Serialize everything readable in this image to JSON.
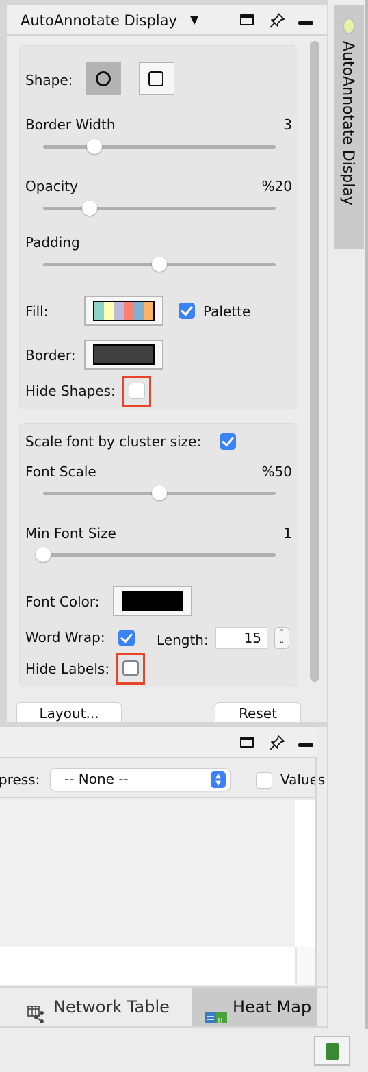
{
  "panel": {
    "title": "AutoAnnotate Display",
    "dropdown_icon": "triangle-down-icon",
    "header_icons": [
      "maximize-icon",
      "pin-icon",
      "minimize-icon"
    ]
  },
  "shape_group": {
    "shape_label": "Shape:",
    "shapes": [
      {
        "name": "ellipse",
        "icon": "circle-icon",
        "selected": true
      },
      {
        "name": "rectangle",
        "icon": "square-icon",
        "selected": false
      }
    ],
    "border_width": {
      "label": "Border Width",
      "value": "3",
      "fraction": 0.22
    },
    "opacity": {
      "label": "Opacity",
      "value": "%20",
      "fraction": 0.2
    },
    "padding": {
      "label": "Padding",
      "value": "",
      "fraction": 0.5
    },
    "fill": {
      "label": "Fill:",
      "palette_colors": [
        "#8dd3c7",
        "#ffffb3",
        "#bebada",
        "#fb8072",
        "#80b1d3",
        "#fdb462"
      ]
    },
    "palette": {
      "label": "Palette",
      "checked": true
    },
    "border": {
      "label": "Border:",
      "color": "#404040"
    },
    "hide_shapes": {
      "label": "Hide Shapes:",
      "checked": false
    }
  },
  "label_group": {
    "scale_font": {
      "label": "Scale font by cluster size:",
      "checked": true
    },
    "font_scale": {
      "label": "Font Scale",
      "value": "%50",
      "fraction": 0.5
    },
    "min_font_size": {
      "label": "Min Font Size",
      "value": "1",
      "fraction": 0.0
    },
    "font_color": {
      "label": "Font Color:",
      "color": "#000000"
    },
    "word_wrap": {
      "label": "Word Wrap:",
      "checked": true
    },
    "length": {
      "label": "Length:",
      "value": "15"
    },
    "hide_labels": {
      "label": "Hide Labels:",
      "checked": false
    }
  },
  "buttons": {
    "layout": "Layout...",
    "reset": "Reset"
  },
  "lower_panel": {
    "express_label": "press:",
    "express_select": "-- None --",
    "values_label": "Values"
  },
  "tabs": [
    {
      "label": "Network Table",
      "icon": "network-table-icon",
      "active": false
    },
    {
      "label": "Heat Map",
      "icon": "heat-map-icon",
      "active": true
    }
  ],
  "side_tab": {
    "label": "AutoAnnotate Display",
    "icon": "autoannotate-icon"
  },
  "status": {
    "memory_icon": "memory-chip-icon"
  },
  "colors": {
    "accent": "#3b82f6",
    "highlight": "#e8442a"
  }
}
